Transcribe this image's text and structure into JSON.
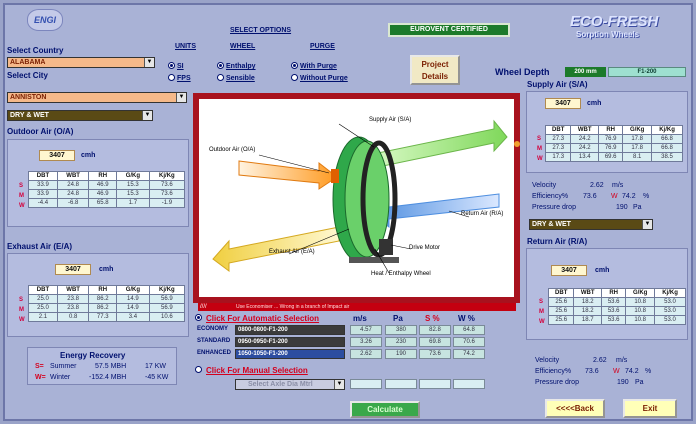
{
  "logo_text": "ENGI",
  "header": {
    "select_options": "SELECT OPTIONS",
    "units_label": "UNITS",
    "wheel_label": "WHEEL",
    "purge_label": "PURGE",
    "eurovent": "EUROVENT CERTIFIED",
    "brand": "ECO-FRESH",
    "brand_sub": "Sorption Wheels",
    "project_details": "Project Details",
    "wheel_depth_label": "Wheel Depth",
    "wheel_depth_value": "200 mm",
    "wheel_model": "F1-200"
  },
  "units_options": [
    "SI",
    "FPS"
  ],
  "wheel_options": [
    "Enthalpy",
    "Sensible"
  ],
  "purge_options": [
    "With Purge",
    "Without Purge"
  ],
  "country": {
    "label": "Select Country",
    "value": "ALABAMA"
  },
  "city": {
    "label": "Select City",
    "value": "ANNISTON"
  },
  "outdoor_db_combo": "DRY & WET",
  "outdoor": {
    "title": "Outdoor Air (O/A)",
    "flow": "3407",
    "unit": "cmh",
    "headers": [
      "DBT",
      "WBT",
      "RH",
      "G/Kg",
      "Kj/Kg"
    ],
    "rows": [
      {
        "label": "S",
        "cells": [
          "33.9",
          "24.8",
          "46.9",
          "15.3",
          "73.6"
        ]
      },
      {
        "label": "M",
        "cells": [
          "33.9",
          "24.8",
          "46.9",
          "15.3",
          "73.6"
        ]
      },
      {
        "label": "W",
        "cells": [
          "-4.4",
          "-6.8",
          "65.8",
          "1.7",
          "-1.9"
        ]
      }
    ]
  },
  "exhaust": {
    "title": "Exhaust Air (E/A)",
    "flow": "3407",
    "unit": "cmh",
    "headers": [
      "DBT",
      "WBT",
      "RH",
      "G/Kg",
      "Kj/Kg"
    ],
    "rows": [
      {
        "label": "S",
        "cells": [
          "25.0",
          "23.8",
          "86.2",
          "14.9",
          "56.9"
        ]
      },
      {
        "label": "M",
        "cells": [
          "25.0",
          "23.8",
          "86.2",
          "14.9",
          "56.9"
        ]
      },
      {
        "label": "W",
        "cells": [
          "2.1",
          "0.8",
          "77.3",
          "3.4",
          "10.6"
        ]
      }
    ]
  },
  "energy": {
    "title": "Energy Recovery",
    "s_label": "S=",
    "s_name": "Summer",
    "s_val1": "57.5 MBH",
    "s_val2": "17 KW",
    "w_label": "W=",
    "w_name": "Winter",
    "w_val1": "-152.4 MBH",
    "w_val2": "-45 KW"
  },
  "supply": {
    "title": "Supply Air (S/A)",
    "flow": "3407",
    "unit": "cmh",
    "headers": [
      "DBT",
      "WBT",
      "RH",
      "G/Kg",
      "Kj/Kg"
    ],
    "rows": [
      {
        "label": "S",
        "cells": [
          "27.3",
          "24.2",
          "76.9",
          "17.8",
          "66.8"
        ]
      },
      {
        "label": "M",
        "cells": [
          "27.3",
          "24.2",
          "76.9",
          "17.8",
          "66.8"
        ]
      },
      {
        "label": "W",
        "cells": [
          "17.3",
          "13.4",
          "69.6",
          "8.1",
          "38.5"
        ]
      }
    ],
    "velocity_label": "Velocity",
    "velocity": "2.62",
    "velocity_unit": "m/s",
    "eff_label": "Efficiency%",
    "eff_value": "73.6",
    "eff_w": "W",
    "eff_w_value": "74.2",
    "eff_pct": "%",
    "pd_label": "Pressure drop",
    "pd_value": "190",
    "pd_unit": "Pa"
  },
  "return_combo": "DRY & WET",
  "return_air": {
    "title": "Return Air (R/A)",
    "flow": "3407",
    "unit": "cmh",
    "headers": [
      "DBT",
      "WBT",
      "RH",
      "G/Kg",
      "Kj/Kg"
    ],
    "rows": [
      {
        "label": "S",
        "cells": [
          "25.6",
          "18.2",
          "53.6",
          "10.8",
          "53.0"
        ]
      },
      {
        "label": "M",
        "cells": [
          "25.6",
          "18.2",
          "53.6",
          "10.8",
          "53.0"
        ]
      },
      {
        "label": "W",
        "cells": [
          "25.6",
          "18.7",
          "53.6",
          "10.8",
          "53.0"
        ]
      }
    ],
    "velocity_label": "Velocity",
    "velocity": "2.62",
    "velocity_unit": "m/s",
    "eff_label": "Efficiency%",
    "eff_value": "73.6",
    "eff_w": "W",
    "eff_w_value": "74.2",
    "eff_pct": "%",
    "pd_label": "Pressure drop",
    "pd_value": "190",
    "pd_unit": "Pa"
  },
  "diagram": {
    "supply": "Supply Air (S/A)",
    "outdoor": "Outdoor Air (O/A)",
    "return": "Return Air (R/A)",
    "motor": "Drive Motor",
    "exhaust": "Exhaust Air (E/A)",
    "wheel": "Heat / Enthalpy Wheel"
  },
  "warning": "Use Economiser ... Wrong in a branch of Impact air",
  "selection": {
    "auto_link": "Click For Automatic Selection",
    "col_mps": "m/s",
    "col_pa": "Pa",
    "col_s": "S %",
    "col_w": "W %",
    "rows": [
      {
        "label": "ECONOMY",
        "model": "0800-0800-F1-200",
        "vals": [
          "4.57",
          "380",
          "82.8",
          "64.8"
        ]
      },
      {
        "label": "STANDARD",
        "model": "0950-0950-F1-200",
        "vals": [
          "3.26",
          "230",
          "69.8",
          "70.6"
        ]
      },
      {
        "label": "ENHANCED",
        "model": "1050-1050-F1-200",
        "vals": [
          "2.62",
          "190",
          "73.6",
          "74.2"
        ]
      }
    ],
    "manual_link": "Click For Manual Selection",
    "manual_combo": "Select Axle Dia Mtrl"
  },
  "buttons": {
    "calculate": "Calculate",
    "back": "<<<<Back",
    "exit": "Exit"
  },
  "colors": {
    "bg": "#a9b2d6",
    "accent_red": "#d4001e",
    "eurovent_green": "#1c7a2a"
  }
}
